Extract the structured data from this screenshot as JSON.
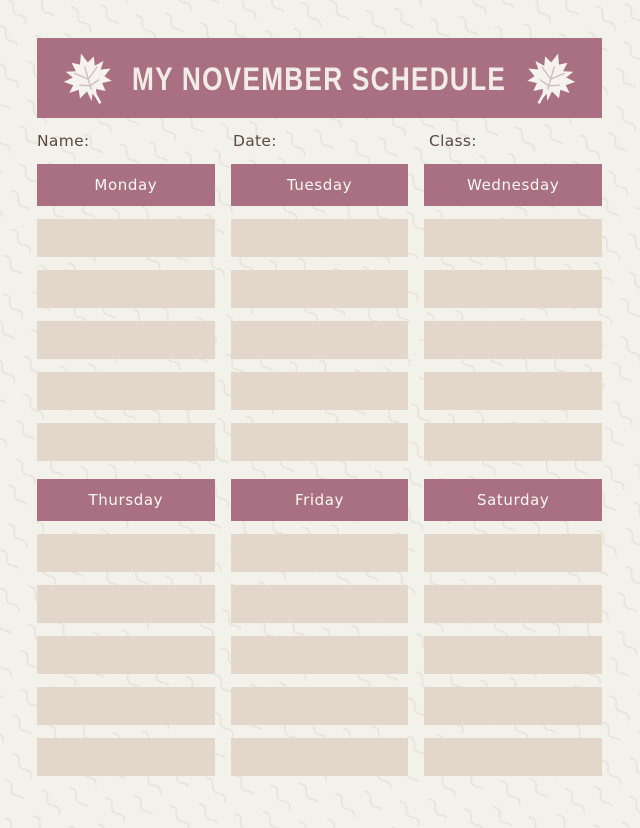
{
  "page": {
    "title": "MY NOVEMBER SCHEDULE",
    "background_color": "#f2f1ea",
    "accent_color": "#a96f82",
    "slot_color": "#e3d6cb",
    "text_color": "#5a4a42",
    "header_text_color": "#f2ece7"
  },
  "decorations": {
    "left_leaf": "maple-leaf-icon",
    "right_leaf": "maple-leaf-icon"
  },
  "info_fields": [
    {
      "label": "Name:",
      "value": ""
    },
    {
      "label": "Date:",
      "value": ""
    },
    {
      "label": "Class:",
      "value": ""
    }
  ],
  "sections": [
    {
      "days": [
        {
          "label": "Monday",
          "slots": [
            "",
            "",
            "",
            "",
            ""
          ]
        },
        {
          "label": "Tuesday",
          "slots": [
            "",
            "",
            "",
            "",
            ""
          ]
        },
        {
          "label": "Wednesday",
          "slots": [
            "",
            "",
            "",
            "",
            ""
          ]
        }
      ]
    },
    {
      "days": [
        {
          "label": "Thursday",
          "slots": [
            "",
            "",
            "",
            "",
            ""
          ]
        },
        {
          "label": "Friday",
          "slots": [
            "",
            "",
            "",
            "",
            ""
          ]
        },
        {
          "label": "Saturday",
          "slots": [
            "",
            "",
            "",
            "",
            ""
          ]
        }
      ]
    }
  ]
}
